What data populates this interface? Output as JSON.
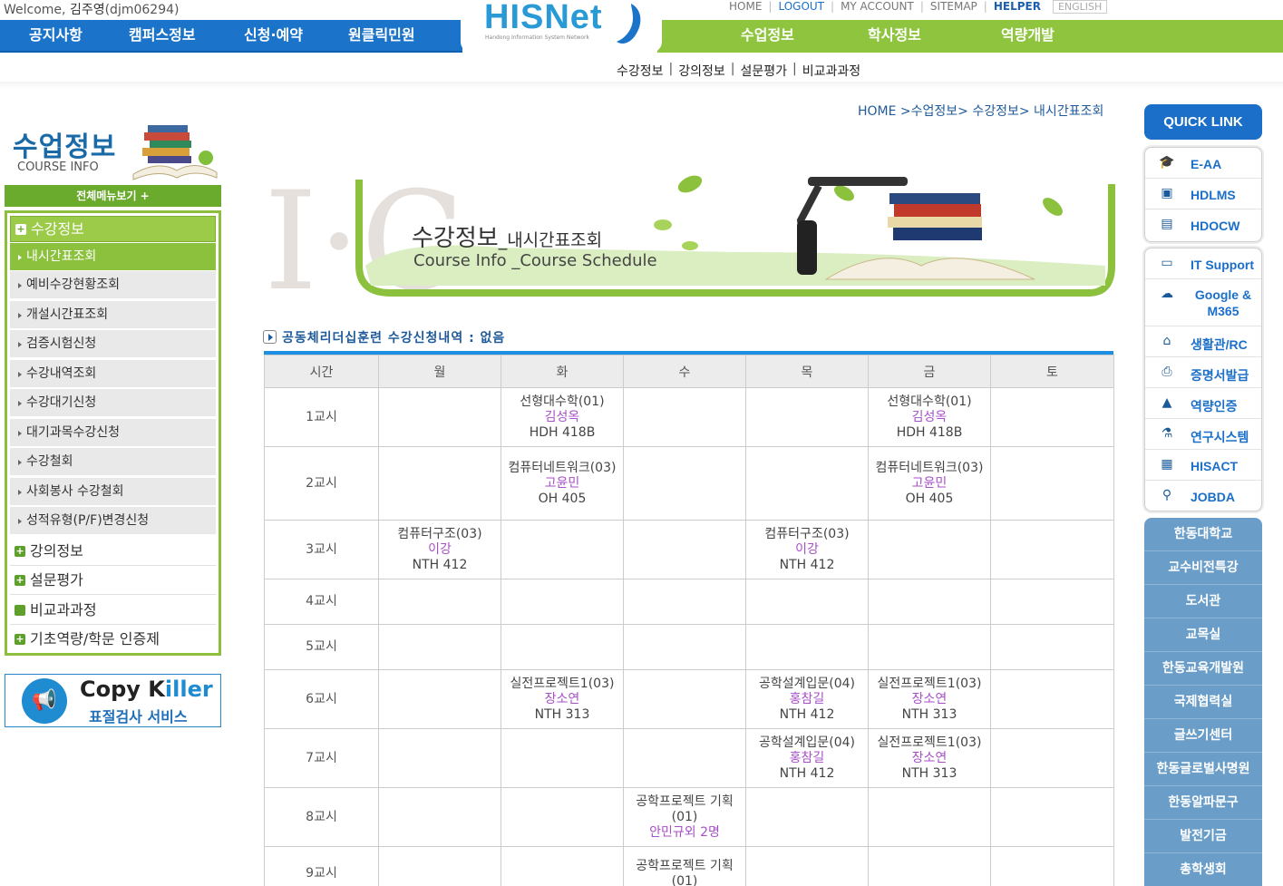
{
  "header": {
    "welcome_prefix": "Welcome,",
    "user_name": "김주영",
    "user_id": "(djm06294)",
    "logo_text": "HISNet",
    "logo_sub": "Handong Information System Network",
    "top_links": {
      "home": "HOME",
      "logout": "LOGOUT",
      "account": "MY ACCOUNT",
      "sitemap": "SITEMAP",
      "helper": "HELPER",
      "english": "ENGLISH"
    },
    "nav_left": [
      "공지사항",
      "캠퍼스정보",
      "신청·예약",
      "원클릭민원"
    ],
    "nav_right": [
      "수업정보",
      "학사정보",
      "역량개발"
    ],
    "subnav": [
      "수강정보",
      "강의정보",
      "설문평가",
      "비교과과정"
    ],
    "accent_blue": "#1b74c9",
    "accent_green": "#8fc53e"
  },
  "sidebar": {
    "title": "수업정보",
    "subtitle": "COURSE INFO",
    "all_menu": "전체메뉴보기 +",
    "active_group": "수강정보",
    "sub_items": [
      "내시간표조회",
      "예비수강현황조회",
      "개설시간표조회",
      "검증시험신청",
      "수강내역조회",
      "수강대기신청",
      "대기과목수강신청",
      "수강철회",
      "사회봉사 수강철회",
      "성적유형(P/F)변경신청"
    ],
    "groups": [
      "강의정보",
      "설문평가",
      "비교과과정",
      "기초역량/학문 인증제"
    ],
    "copykiller_title_a": "Copy K",
    "copykiller_title_b": "iller",
    "copykiller_sub": "표절검사 서비스"
  },
  "main": {
    "breadcrumb": "HOME >수업정보> 수강정보> 내시간표조회",
    "banner_title": "수강정보",
    "banner_title_sub": "_내시간표조회",
    "banner_en": "Course Info _Course Schedule",
    "reg_title": "공동체리더십훈련 수강신청내역 : 없음",
    "table_headers": [
      "시간",
      "월",
      "화",
      "수",
      "목",
      "금",
      "토"
    ],
    "rows": [
      {
        "period": "1교시",
        "cells": [
          null,
          {
            "name": "선형대수학(01)",
            "prof": "김성옥",
            "room": "HDH 418B"
          },
          null,
          null,
          {
            "name": "선형대수학(01)",
            "prof": "김성옥",
            "room": "HDH 418B"
          },
          null
        ]
      },
      {
        "period": "2교시",
        "cells": [
          null,
          {
            "name": "컴퓨터네트워크(03)",
            "prof": "고윤민",
            "room": "OH 405"
          },
          null,
          null,
          {
            "name": "컴퓨터네트워크(03)",
            "prof": "고윤민",
            "room": "OH 405"
          },
          null
        ]
      },
      {
        "period": "3교시",
        "cells": [
          {
            "name": "컴퓨터구조(03)",
            "prof": "이강",
            "room": "NTH 412"
          },
          null,
          null,
          {
            "name": "컴퓨터구조(03)",
            "prof": "이강",
            "room": "NTH 412"
          },
          null,
          null
        ]
      },
      {
        "period": "4교시",
        "cells": [
          null,
          null,
          null,
          null,
          null,
          null
        ]
      },
      {
        "period": "5교시",
        "cells": [
          null,
          null,
          null,
          null,
          null,
          null
        ]
      },
      {
        "period": "6교시",
        "cells": [
          null,
          {
            "name": "실전프로젝트1(03)",
            "prof": "장소연",
            "room": "NTH 313"
          },
          null,
          {
            "name": "공학설계입문(04)",
            "prof": "홍참길",
            "room": "NTH 412"
          },
          {
            "name": "실전프로젝트1(03)",
            "prof": "장소연",
            "room": "NTH 313"
          },
          null
        ]
      },
      {
        "period": "7교시",
        "cells": [
          null,
          null,
          null,
          {
            "name": "공학설계입문(04)",
            "prof": "홍참길",
            "room": "NTH 412"
          },
          {
            "name": "실전프로젝트1(03)",
            "prof": "장소연",
            "room": "NTH 313"
          },
          null
        ]
      },
      {
        "period": "8교시",
        "cells": [
          null,
          null,
          {
            "name": "공학프로젝트 기획(01)",
            "prof": "안민규외 2명",
            "room": ""
          },
          null,
          null,
          null
        ]
      },
      {
        "period": "9교시",
        "cells": [
          null,
          null,
          {
            "name": "공학프로젝트 기획(01)",
            "prof": "",
            "room": ""
          },
          null,
          null,
          null
        ]
      }
    ]
  },
  "quicklink": {
    "title": "QUICK LINK",
    "group1": [
      {
        "label": "E-AA",
        "icon": "graduation-cap-icon",
        "glyph": "🎓"
      },
      {
        "label": "HDLMS",
        "icon": "presentation-icon",
        "glyph": "▣"
      },
      {
        "label": "HDOCW",
        "icon": "document-play-icon",
        "glyph": "▤"
      }
    ],
    "group2": [
      {
        "label": "IT Support",
        "icon": "monitor-icon",
        "glyph": "▭"
      },
      {
        "label": "Google & M365",
        "icon": "cloud-icon",
        "glyph": "☁"
      },
      {
        "label": "생활관/RC",
        "icon": "home-icon",
        "glyph": "⌂"
      },
      {
        "label": "증명서발급",
        "icon": "printer-icon",
        "glyph": "⎙"
      },
      {
        "label": "역량인증",
        "icon": "chart-icon",
        "glyph": "▲"
      },
      {
        "label": "연구시스템",
        "icon": "flask-icon",
        "glyph": "⚗"
      },
      {
        "label": "HISACT",
        "icon": "clipboard-icon",
        "glyph": "▦"
      },
      {
        "label": "JOBDA",
        "icon": "search-chart-icon",
        "glyph": "⚲"
      }
    ],
    "links": [
      "한동대학교",
      "교수비전특강",
      "도서관",
      "교목실",
      "한동교육개발원",
      "국제협력실",
      "글쓰기센터",
      "한동글로벌사명원",
      "한동알파문구",
      "발전기금",
      "총학생회"
    ]
  }
}
